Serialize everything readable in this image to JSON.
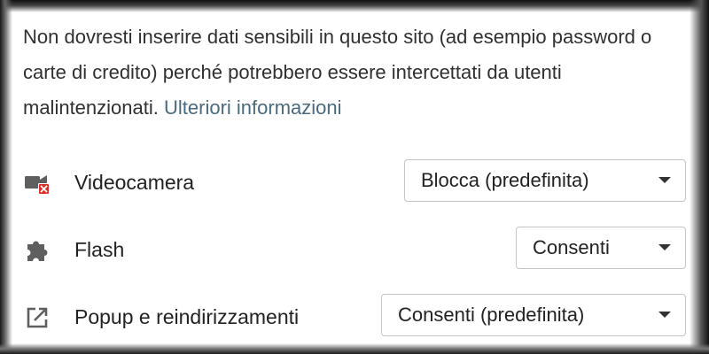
{
  "notice": {
    "text": "Non dovresti inserire dati sensibili in questo sito (ad esempio password o carte di credito) perché potrebbero essere intercettati da utenti malintenzionati.",
    "link": "Ulteriori informazioni"
  },
  "permissions": [
    {
      "icon": "videocamera-blocked-icon",
      "label": "Videocamera",
      "value": "Blocca (predefinita)"
    },
    {
      "icon": "puzzle-piece-icon",
      "label": "Flash",
      "value": "Consenti"
    },
    {
      "icon": "external-link-icon",
      "label": "Popup e reindirizzamenti",
      "value": "Consenti (predefinita)"
    }
  ],
  "colors": {
    "link": "#4a6a7e",
    "blocked_badge": "#d93025",
    "icon": "#5f5f5f"
  }
}
